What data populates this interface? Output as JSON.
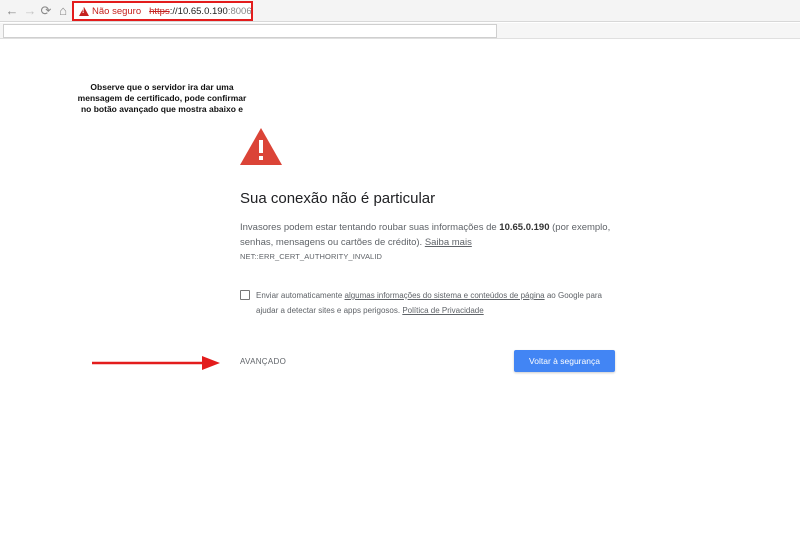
{
  "browser": {
    "security_label": "Não seguro",
    "url_scheme": "https",
    "url_scheme_sep": "://",
    "url_host": "10.65.0.190",
    "url_port": ":8006",
    "icons": {
      "back": "arrow-left-icon",
      "forward": "arrow-right-icon",
      "reload": "reload-icon",
      "home": "home-icon"
    }
  },
  "annotation": {
    "note": "Observe que o servidor ira dar uma mensagem de certificado, pode confirmar no botão avançado que mostra abaixo e",
    "highlight_color": "#e31c1c"
  },
  "interstitial": {
    "title": "Sua conexão não é particular",
    "body_prefix": "Invasores podem estar tentando roubar suas informações de ",
    "body_host": "10.65.0.190",
    "body_suffix": " (por exemplo, senhas, mensagens ou cartões de crédito). ",
    "learn_more": "Saiba mais",
    "error_code": "NET::ERR_CERT_AUTHORITY_INVALID",
    "optin_prefix": "Enviar automaticamente ",
    "optin_link": "algumas informações do sistema e conteúdos de página",
    "optin_middle": " ao Google para ajudar a detectar sites e apps perigosos. ",
    "privacy_link": "Política de Privacidade",
    "advanced_label": "AVANÇADO",
    "back_button_label": "Voltar à segurança",
    "warning_color": "#db4437",
    "button_color": "#4285f4"
  }
}
